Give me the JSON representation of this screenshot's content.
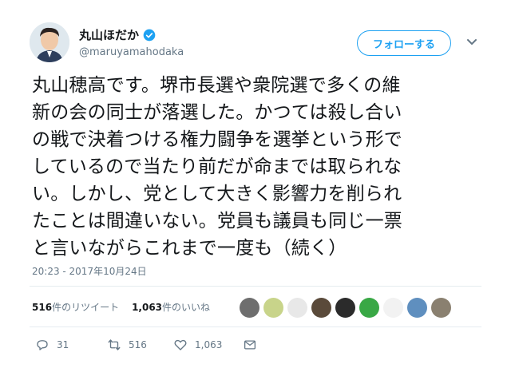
{
  "author": {
    "display_name": "丸山ほだか",
    "handle": "@maruyamahodaka",
    "verified": true
  },
  "follow_button": {
    "label": "フォローする"
  },
  "tweet": {
    "text": "丸山穂高です。堺市長選や衆院選で多くの維\n新の会の同士が落選した。かつては殺し合い\nの戦で決着つける権力闘争を選挙という形で\nしているので当たり前だが命までは取られな\nい。しかし、党として大きく影響力を削られ\nたことは間違いない。党員も議員も同じ一票\nと言いながらこれまで一度も（続く）",
    "timestamp": "20:23 - 2017年10月24日"
  },
  "stats": {
    "retweets_count": "516",
    "retweets_label": "件のリツイート",
    "likes_count": "1,063",
    "likes_label": "件のいいね"
  },
  "liker_avatars": [
    "#6e6e6e",
    "#c8d48a",
    "#e8e8e8",
    "#5a4a3a",
    "#2b2b2b",
    "#39a845",
    "#f2f2f2",
    "#5f8fbf",
    "#8a8070"
  ],
  "actions": {
    "reply_count": "31",
    "retweet_count": "516",
    "like_count": "1,063"
  },
  "colors": {
    "accent": "#1da1f2",
    "muted": "#657786",
    "text": "#14171a"
  }
}
